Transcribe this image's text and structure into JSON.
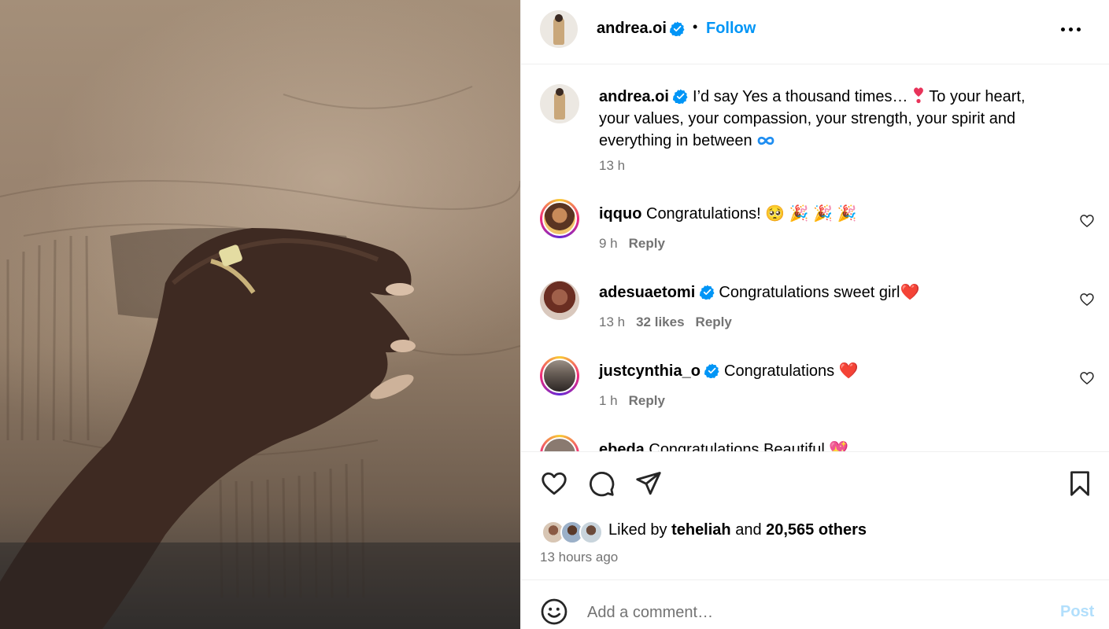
{
  "post": {
    "username": "andrea.oi",
    "separator": "•",
    "follow_label": "Follow",
    "more_icon": "more-horizontal-icon"
  },
  "caption": {
    "username": "andrea.oi",
    "text_before_heart": " I’d say Yes a thousand times… ",
    "text_after_heart": " To your heart, your values, your compassion, your strength, your spirit and everything in between ",
    "time": "13 h"
  },
  "comments": [
    {
      "username": "iqquo",
      "text": " Congratulations! 🥺 🎉 🎉 🎉",
      "time": "9 h",
      "likes": "",
      "reply_label": "Reply",
      "verified": false
    },
    {
      "username": "adesuaetomi",
      "text": " Congratulations sweet girl❤️",
      "time": "13 h",
      "likes": "32 likes",
      "reply_label": "Reply",
      "verified": true
    },
    {
      "username": "justcynthia_o",
      "text": " Congratulations ❤️",
      "time": "1 h",
      "likes": "",
      "reply_label": "Reply",
      "verified": true
    },
    {
      "username": "ebeda",
      "text": " Congratulations Beautiful 💖"
    }
  ],
  "likes": {
    "prefix": "Liked by ",
    "first_user": "teheliah",
    "conjunction": " and ",
    "others": "20,565 others"
  },
  "timestamp": "13 hours ago",
  "add_comment": {
    "placeholder": "Add a comment…",
    "post_label": "Post"
  },
  "colors": {
    "accent": "#0095f6",
    "verified": "#0095f6",
    "muted": "#737373",
    "post_disabled": "#b2dffc"
  }
}
